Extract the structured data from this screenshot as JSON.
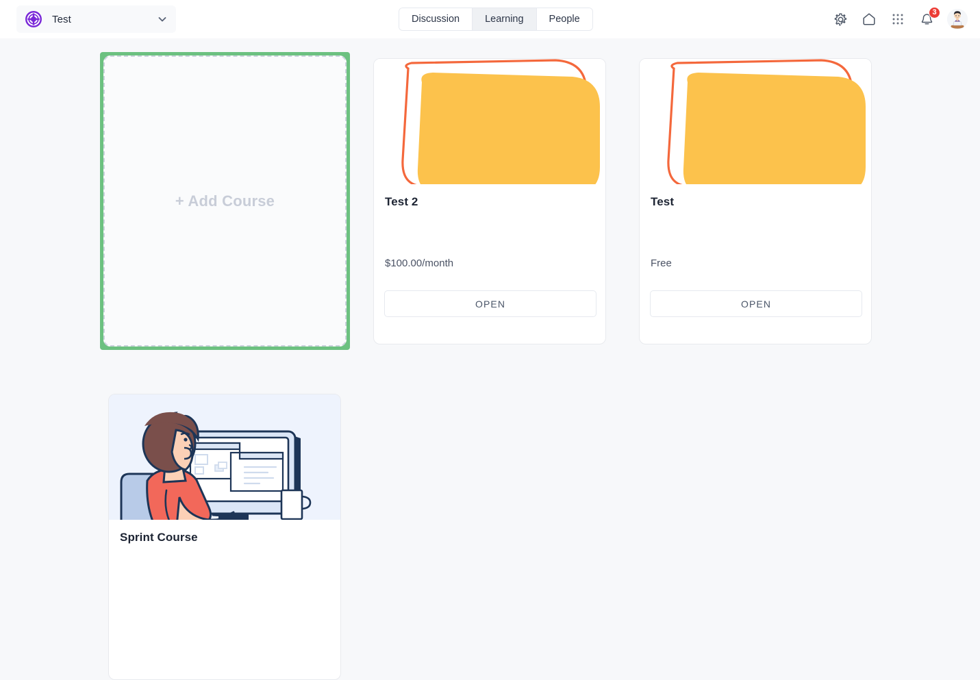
{
  "header": {
    "workspace": {
      "name": "Test",
      "logo_icon": "target-logo-icon",
      "chevron_icon": "chevron-down-icon"
    },
    "tabs": [
      {
        "id": "discussion",
        "label": "Discussion",
        "active": false
      },
      {
        "id": "learning",
        "label": "Learning",
        "active": true
      },
      {
        "id": "people",
        "label": "People",
        "active": false
      }
    ],
    "actions": [
      {
        "id": "settings",
        "icon": "gear-icon"
      },
      {
        "id": "home",
        "icon": "home-icon"
      },
      {
        "id": "apps",
        "icon": "grid-apps-icon"
      },
      {
        "id": "notifications",
        "icon": "bell-icon",
        "badge": "3"
      }
    ],
    "avatar": {
      "icon": "avatar",
      "alt": "user-avatar"
    }
  },
  "main": {
    "add_course": {
      "label": "+ Add Course",
      "highlight_color": "#6cc180"
    },
    "courses": [
      {
        "id": "test-2",
        "title": "Test 2",
        "price": "$100.00/month",
        "open_label": "OPEN",
        "thumb": "abstract-yellow-shape",
        "thumb_colors": {
          "fill": "#fcc24c",
          "outline": "#f4683c"
        }
      },
      {
        "id": "test",
        "title": "Test",
        "price": "Free",
        "open_label": "OPEN",
        "thumb": "abstract-yellow-shape",
        "thumb_colors": {
          "fill": "#fcc24c",
          "outline": "#f4683c"
        }
      },
      {
        "id": "sprint-course",
        "title": "Sprint Course",
        "price": "",
        "open_label": "",
        "thumb": "person-at-computer-illustration",
        "thumb_colors": {
          "background": "#eef3fd",
          "shirt": "#f2685a",
          "hair": "#7a4f4b",
          "outline": "#1d3557",
          "chair": "#b8cbe8"
        }
      }
    ]
  },
  "colors": {
    "page_background": "#f7f8fa",
    "topbar_background": "#ffffff",
    "brand_purple": "#7a28d8",
    "badge_red": "#ec3c35",
    "title_text": "#1d2433"
  }
}
